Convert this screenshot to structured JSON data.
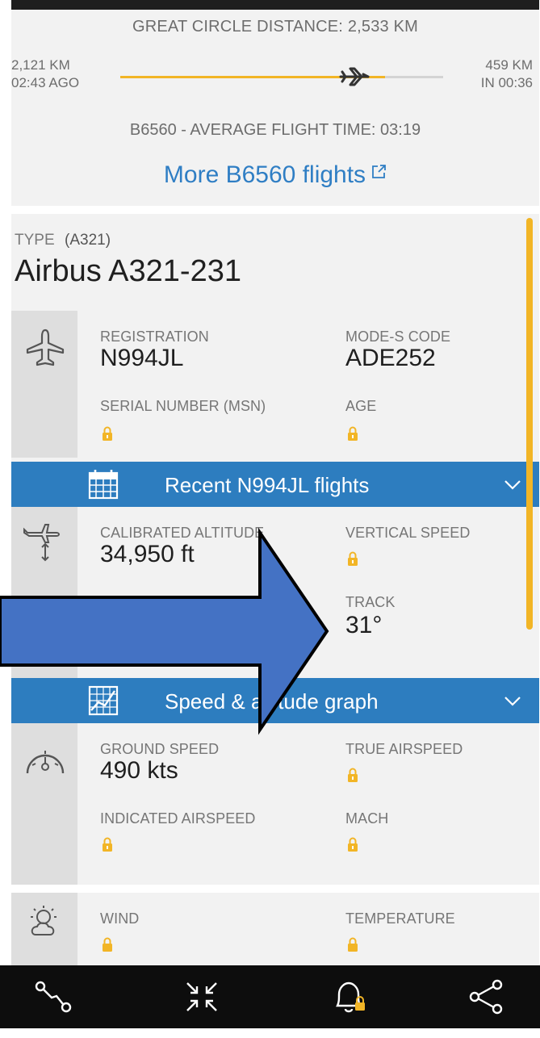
{
  "route": {
    "great_circle_distance": "GREAT CIRCLE DISTANCE: 2,533 KM",
    "left_distance": "2,121 KM",
    "left_time": "02:43 AGO",
    "right_distance": "459 KM",
    "right_time": "IN 00:36",
    "progress": 0.82,
    "average_flight_time": "B6560 - AVERAGE FLIGHT TIME: 03:19",
    "more_flights_link": "More B6560 flights"
  },
  "aircraft_type": {
    "label": "TYPE",
    "code": "(A321)",
    "name": "Airbus A321-231"
  },
  "aircraft": {
    "icon": "airplane-icon",
    "registration_label": "REGISTRATION",
    "registration_value": "N994JL",
    "mode_s_label": "MODE-S CODE",
    "mode_s_value": "ADE252",
    "serial_label": "SERIAL NUMBER (MSN)",
    "age_label": "AGE"
  },
  "recent_flights_bar": {
    "icon": "calendar-icon",
    "label": "Recent N994JL flights"
  },
  "altitude": {
    "icon": "altitude-icon",
    "calibrated_label": "CALIBRATED ALTITUDE",
    "calibrated_value": "34,950 ft",
    "vertical_speed_label": "VERTICAL SPEED",
    "track_label": "TRACK",
    "track_value": "31°"
  },
  "graph_bar": {
    "icon": "graph-icon",
    "label": "Speed & altitude graph"
  },
  "speed": {
    "icon": "speedometer-icon",
    "ground_speed_label": "GROUND SPEED",
    "ground_speed_value": "490 kts",
    "true_airspeed_label": "TRUE AIRSPEED",
    "indicated_airspeed_label": "INDICATED AIRSPEED",
    "mach_label": "MACH"
  },
  "weather": {
    "icon": "weather-icon",
    "wind_label": "WIND",
    "temperature_label": "TEMPERATURE"
  },
  "bottom_nav": {
    "icons": [
      "route-icon",
      "collapse-icon",
      "bell-lock-icon",
      "share-icon"
    ]
  },
  "colors": {
    "accent_blue": "#2d7dbf",
    "link_blue": "#2f7ec4",
    "progress_yellow": "#f2b526",
    "lock_yellow": "#f2b526",
    "overlay_arrow": "#4472c4"
  }
}
